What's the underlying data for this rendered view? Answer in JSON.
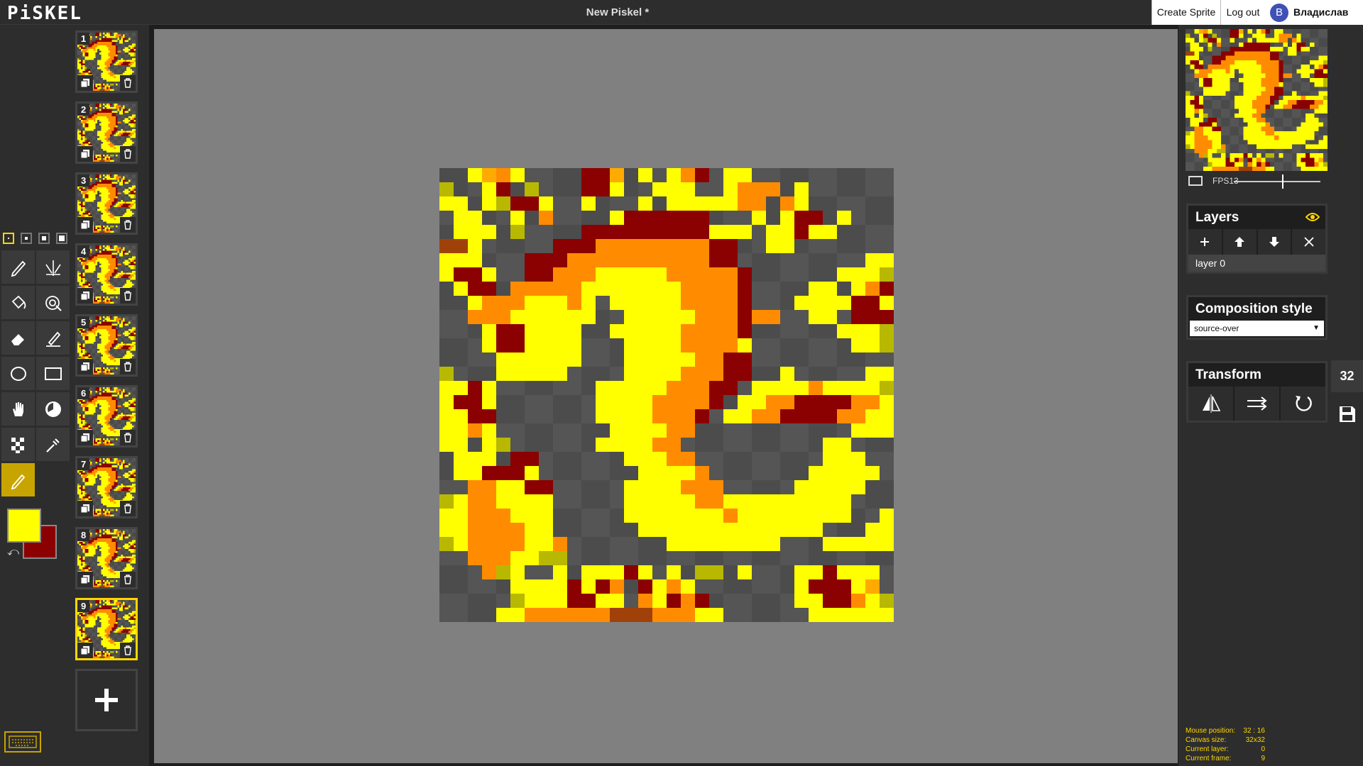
{
  "app": {
    "logo": "PiSKEL",
    "title": "New Piskel *"
  },
  "header": {
    "create_sprite": "Create Sprite",
    "log_out": "Log out",
    "avatar_letter": "B",
    "username": "Владислав"
  },
  "tools": {
    "pen_sizes": [
      1,
      2,
      3,
      4
    ],
    "selected_pen_size": 1,
    "items": [
      {
        "name": "pen-tool-icon"
      },
      {
        "name": "vertical-mirror-pen-icon"
      },
      {
        "name": "paint-bucket-icon"
      },
      {
        "name": "paint-all-same-color-icon"
      },
      {
        "name": "eraser-icon"
      },
      {
        "name": "stroke-tool-icon"
      },
      {
        "name": "circle-tool-icon"
      },
      {
        "name": "rectangle-tool-icon"
      },
      {
        "name": "move-tool-icon"
      },
      {
        "name": "shape-selection-icon"
      },
      {
        "name": "dithering-tool-icon"
      },
      {
        "name": "color-picker-icon"
      },
      {
        "name": "lighten-tool-icon"
      }
    ],
    "selected_tool": "lighten-tool-icon",
    "primary_color": "#ffff00",
    "secondary_color": "#8b0000"
  },
  "frames": {
    "items": [
      {
        "number": "1"
      },
      {
        "number": "2"
      },
      {
        "number": "3"
      },
      {
        "number": "4"
      },
      {
        "number": "5"
      },
      {
        "number": "6"
      },
      {
        "number": "7"
      },
      {
        "number": "8"
      },
      {
        "number": "9"
      }
    ],
    "selected": "9"
  },
  "preview": {
    "fps_label": "FPS13",
    "fps": 13
  },
  "layers": {
    "title": "Layers",
    "items": [
      "layer 0"
    ]
  },
  "composition": {
    "title": "Composition style",
    "value": "source-over"
  },
  "transform": {
    "title": "Transform"
  },
  "side_tabs": {
    "resize": "32"
  },
  "status": [
    {
      "label": "Mouse position:",
      "value": "32 : 16"
    },
    {
      "label": "Canvas size:",
      "value": "32x32"
    },
    {
      "label": "Current layer:",
      "value": "0"
    },
    {
      "label": "Current frame:",
      "value": "9"
    }
  ],
  "sprite": {
    "palette": {
      ".": "",
      "Y": "#ffff00",
      "y": "#b8b800",
      "O": "#ff8c00",
      "o": "#ffaa00",
      "R": "#8b0000",
      "B": "#a0410a"
    },
    "rows": [
      "..YoOY....RRo.Y.YOR.YY..........",
      "y..YR.y...RRY..YYY..YOOO.Y......",
      "YY.YyRRY..Y...Y.YYYYYOO.OY......",
      ".YY..Y.O....YRRRRRR...Y.YRR.Y...",
      ".YYY.y....RRRRRRRRRYYY.YYRYY....",
      "BBY.....RRROOOOOOOORR..YY.......",
      "YYY...RRROOOOOOOOOORR.........YY",
      "YRRY..RROOOYYYYYOOOOOR......YYYy",
      ".YRR.OOOOOYYYYYYYOOOOR....YY.YOR",
      "..YOOOYYYOY.YYYYYOOOOR...YYYYRRY",
      "..OOOYYYYYY..YYYYYOOOROO..YY.RRR",
      "...YRRYYYY..YYYYYOOOOR......YYYy",
      "...YRRYYYY...YYYYOOOOY.......YYy",
      "....YYYYYY...YYYYYOORR...........",
      "y...YYYYY....YYYYOOORR..Y.....YY",
      "YYRY.......YYYYYOOORR.YYYYOYYYYy",
      "YRRY.......YYYYOOOOR.YYOORRRROOY",
      "YYRR.......YYYYOOOR.YYOORRRROOYY",
      "YYOY........YYYYOO...........YYY",
      "YY.Yy......YYYYOO..........YY...",
      ".YYY.RR......YYYOO.........YYY..",
      ".YYRRRY.......YYYYO.......YYYYY.",
      "..OOYYRR.....YYYYOOO.....YYYYY..",
      "yYOOYYYY.....YYYYYOOYYYYYYYYY...",
      "YYOOOYYY.....YYYYYYYOYYYYYYYY..Y",
      "YYOOOOYY......YYYYYYYYYYYYY...YY",
      "yYOOOOYYO.......YYYYYYYY...YYYYY",
      "..OOOYYyy.......................",
      "...OyY..Y.YYYRY.Y.yy.Y...YYRYYY.",
      ".....YYYYRYRO.RYOY.......YRRRYo.",
      ".....yYYYRRYY.OYROR......YYRROYy",
      "....YYOOOOOOBBBOOOYY......YYYYYY"
    ]
  }
}
